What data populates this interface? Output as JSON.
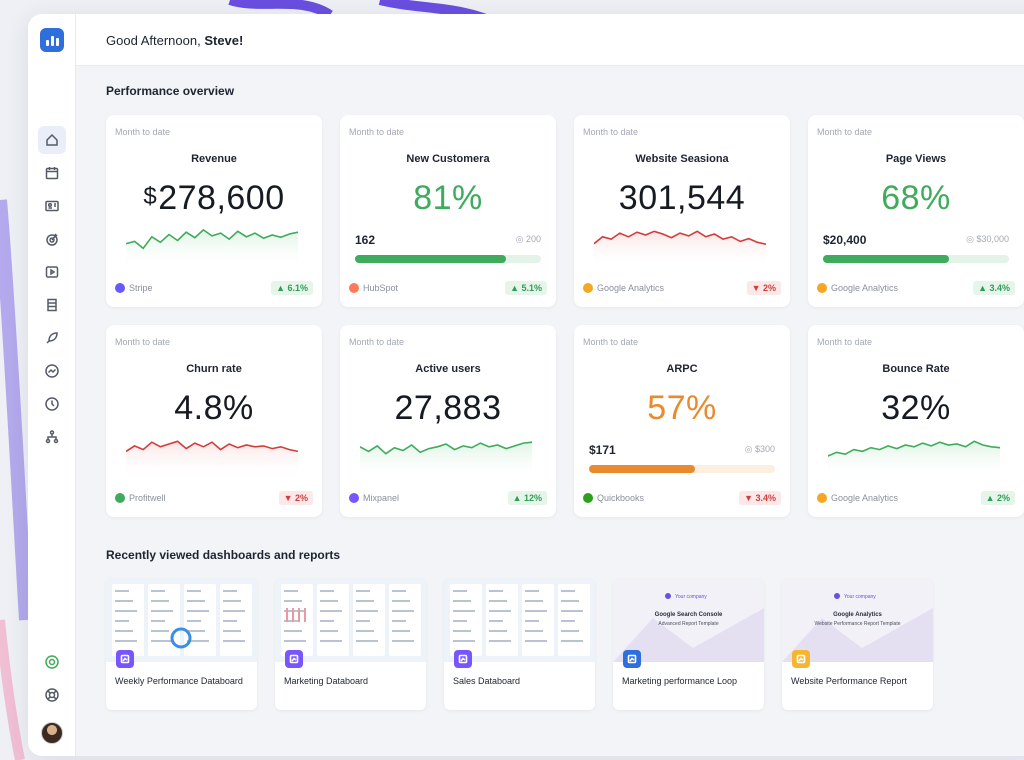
{
  "header": {
    "greeting_prefix": "Good Afternoon,",
    "user_name": "Steve!"
  },
  "sections": {
    "performance_title": "Performance overview",
    "recent_title": "Recently viewed dashboards and reports"
  },
  "sidebar": {
    "icons": [
      "home-icon",
      "calendar-icon",
      "id-card-icon",
      "target-icon",
      "video-icon",
      "stack-icon",
      "rocket-icon",
      "trend-icon",
      "clock-icon",
      "hierarchy-icon"
    ],
    "bottom_icons": [
      "integrations-icon",
      "help-icon"
    ]
  },
  "cards": [
    {
      "period": "Month to date",
      "title": "Revenue",
      "currency": "$",
      "value": "278,600",
      "value_color": "#161a22",
      "type": "spark",
      "line_color": "#3fab5c",
      "fill_color": "#dff3e4",
      "spark": [
        0.45,
        0.4,
        0.55,
        0.3,
        0.42,
        0.25,
        0.38,
        0.2,
        0.32,
        0.15,
        0.28,
        0.22,
        0.35,
        0.18,
        0.3,
        0.22,
        0.33,
        0.26,
        0.31,
        0.24,
        0.2
      ],
      "source": "Stripe",
      "source_color": "#635bff",
      "change": "6.1%",
      "trend": "up"
    },
    {
      "period": "Month to date",
      "title": "New Customera",
      "currency": "",
      "value": "81%",
      "value_color": "#3fab5c",
      "type": "progress",
      "current": "162",
      "goal": "200",
      "progress": 0.81,
      "bar_color": "#3fab5c",
      "track_color": "#e3f3e7",
      "source": "HubSpot",
      "source_color": "#ff7a59",
      "change": "5.1%",
      "trend": "up"
    },
    {
      "period": "Month to date",
      "title": "Website Seasiona",
      "currency": "",
      "value": "301,544",
      "value_color": "#161a22",
      "type": "spark",
      "line_color": "#d43b3b",
      "fill_color": "#fbe4e4",
      "spark": [
        0.45,
        0.3,
        0.35,
        0.22,
        0.3,
        0.2,
        0.26,
        0.18,
        0.24,
        0.32,
        0.22,
        0.28,
        0.18,
        0.3,
        0.24,
        0.35,
        0.3,
        0.4,
        0.34,
        0.42,
        0.46
      ],
      "source": "Google Analytics",
      "source_color": "#f5a623",
      "change": "2%",
      "trend": "down"
    },
    {
      "period": "Month to date",
      "title": "Page Views",
      "currency": "",
      "value": "68%",
      "value_color": "#3fab5c",
      "type": "progress",
      "current": "$20,400",
      "goal": "$30,000",
      "progress": 0.68,
      "bar_color": "#3fab5c",
      "track_color": "#e3f3e7",
      "source": "Google Analytics",
      "source_color": "#f5a623",
      "change": "3.4%",
      "trend": "up"
    },
    {
      "period": "Month to date",
      "title": "Churn rate",
      "currency": "",
      "value": "4.8%",
      "value_color": "#161a22",
      "type": "spark",
      "line_color": "#d43b3b",
      "fill_color": "#fbe4e4",
      "spark": [
        0.4,
        0.28,
        0.36,
        0.2,
        0.3,
        0.24,
        0.18,
        0.34,
        0.22,
        0.3,
        0.2,
        0.36,
        0.24,
        0.32,
        0.26,
        0.3,
        0.28,
        0.34,
        0.3,
        0.36,
        0.4
      ],
      "source": "Profitwell",
      "source_color": "#3fab5c",
      "change": "2%",
      "trend": "down"
    },
    {
      "period": "Month to date",
      "title": "Active users",
      "currency": "",
      "value": "27,883",
      "value_color": "#161a22",
      "type": "spark",
      "line_color": "#3fab5c",
      "fill_color": "#dff3e4",
      "spark": [
        0.3,
        0.4,
        0.28,
        0.45,
        0.32,
        0.38,
        0.26,
        0.42,
        0.34,
        0.3,
        0.24,
        0.36,
        0.28,
        0.32,
        0.22,
        0.3,
        0.26,
        0.34,
        0.28,
        0.22,
        0.2
      ],
      "source": "Mixpanel",
      "source_color": "#7856ff",
      "change": "12%",
      "trend": "up"
    },
    {
      "period": "Month to date",
      "title": "ARPC",
      "currency": "",
      "value": "57%",
      "value_color": "#ea8a2e",
      "type": "progress",
      "current": "$171",
      "goal": "$300",
      "progress": 0.57,
      "bar_color": "#ea8a2e",
      "track_color": "#fcefe0",
      "source": "Quickbooks",
      "source_color": "#2ca01c",
      "change": "3.4%",
      "trend": "down"
    },
    {
      "period": "Month to date",
      "title": "Bounce Rate",
      "currency": "",
      "value": "32%",
      "value_color": "#161a22",
      "type": "spark",
      "line_color": "#3fab5c",
      "fill_color": "#dff3e4",
      "spark": [
        0.5,
        0.42,
        0.46,
        0.36,
        0.4,
        0.32,
        0.36,
        0.28,
        0.34,
        0.26,
        0.3,
        0.22,
        0.28,
        0.2,
        0.26,
        0.24,
        0.3,
        0.18,
        0.26,
        0.3,
        0.32
      ],
      "source": "Google Analytics",
      "source_color": "#f5a623",
      "change": "2%",
      "trend": "up"
    }
  ],
  "recent": [
    {
      "title": "Weekly Performance Databoard",
      "badge_color": "#7856ff",
      "thumb": "dashboard"
    },
    {
      "title": "Marketing Databoard",
      "badge_color": "#7856ff",
      "thumb": "dashboard"
    },
    {
      "title": "Sales Databoard",
      "badge_color": "#7856ff",
      "thumb": "dashboard"
    },
    {
      "title": "Marketing performance Loop",
      "badge_color": "#2f6fdd",
      "thumb": "template",
      "company": "Your company",
      "heading": "Google Search Console",
      "subheading": "Advanced Report Template"
    },
    {
      "title": "Website Performance Report",
      "badge_color": "#f5b52e",
      "thumb": "template",
      "company": "Your company",
      "heading": "Google Analytics",
      "subheading": "Website Performance Report Template"
    }
  ]
}
